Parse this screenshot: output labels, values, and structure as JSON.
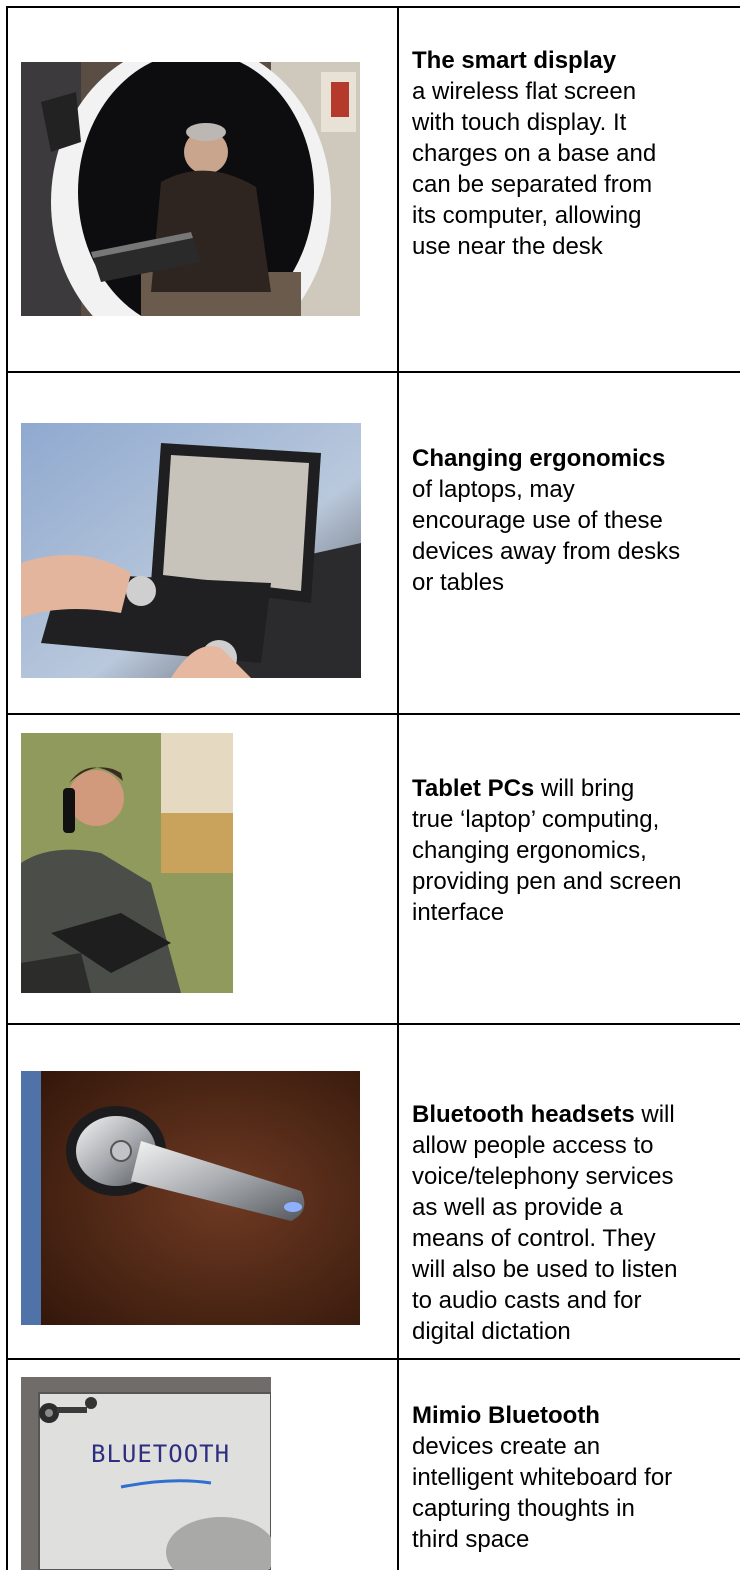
{
  "rows": [
    {
      "title": "The smart display",
      "lines": [
        "a wireless flat screen",
        "with touch display. It",
        "charges on a base and",
        "can be separated from",
        "its computer, allowing",
        "use near the desk"
      ]
    },
    {
      "title": "Changing ergonomics",
      "lines": [
        "of laptops, may",
        "encourage use of these",
        "devices away from desks",
        "or tables"
      ]
    },
    {
      "title": "Tablet PCs",
      "title_tail": " will bring",
      "lines": [
        "true ‘laptop’ computing,",
        "changing ergonomics,",
        "providing pen and screen",
        "interface"
      ]
    },
    {
      "title": "Bluetooth headsets",
      "title_tail": " will",
      "lines": [
        "allow people access to",
        "voice/telephony services",
        "as well as provide a",
        "means of control. They",
        "will also be used to listen",
        "to audio casts and for",
        "digital dictation"
      ]
    },
    {
      "title": "Mimio Bluetooth",
      "lines": [
        "devices create an",
        "intelligent whiteboard for",
        "capturing thoughts in",
        "third space"
      ]
    }
  ],
  "whiteboard_text": "BLUETOOTH"
}
